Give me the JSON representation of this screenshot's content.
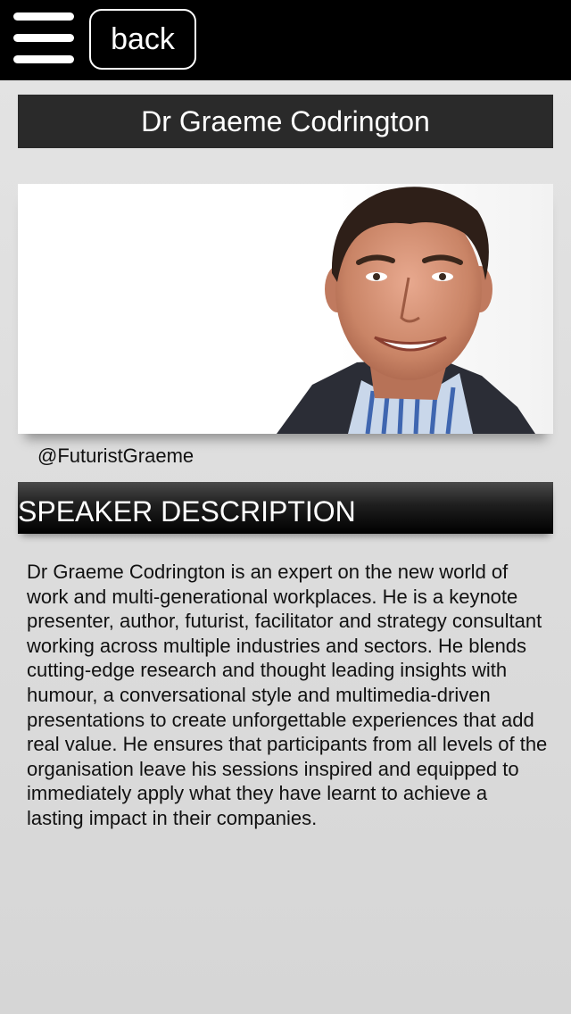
{
  "header": {
    "menu_icon": "hamburger-menu-icon",
    "back_label": "back"
  },
  "speaker": {
    "name": "Dr Graeme Codrington",
    "handle": "@FuturistGraeme",
    "photo": "speaker-portrait"
  },
  "section": {
    "title": "SPEAKER DESCRIPTION"
  },
  "description": "Dr Graeme Codrington is an expert on the new world of work and multi-generational workplaces. He is a keynote presenter, author, futurist, facilitator and strategy consultant working across multiple industries and sectors. He blends cutting-edge research and thought leading insights with humour, a conversational style and multimedia-driven presentations to create unforgettable experiences that add real value. He ensures that participants from all levels of the organisation leave his sessions inspired and equipped to immediately apply what they have learnt to achieve a lasting impact in their companies.",
  "colors": {
    "topbar": "#000000",
    "banner": "#2a2a2a",
    "background": "#dcdcdc"
  }
}
